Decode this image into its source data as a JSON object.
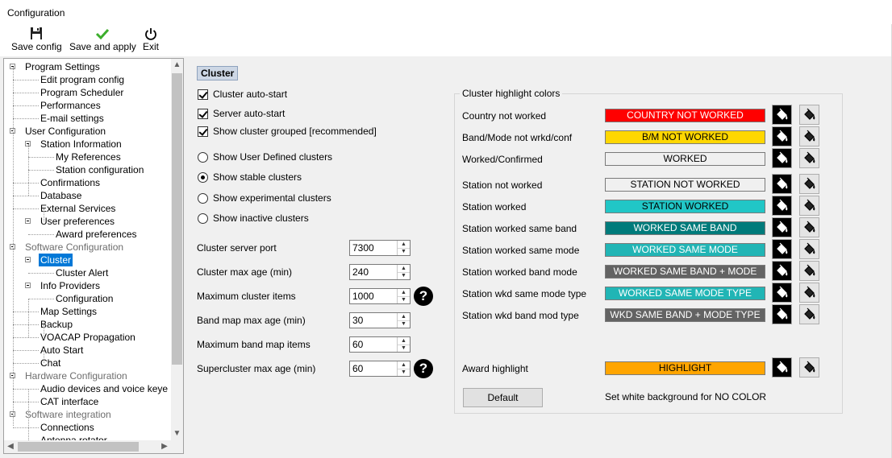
{
  "window": {
    "title": "Configuration"
  },
  "toolbar": {
    "save_config": "Save config",
    "save_apply": "Save and apply",
    "exit": "Exit"
  },
  "tree": {
    "nodes": [
      {
        "label": "Program Settings",
        "level": 0,
        "expanded": true,
        "grey": false
      },
      {
        "label": "Edit program config",
        "level": 1
      },
      {
        "label": "Program Scheduler",
        "level": 1
      },
      {
        "label": "Performances",
        "level": 1
      },
      {
        "label": "E-mail settings",
        "level": 1
      },
      {
        "label": "User Configuration",
        "level": 0,
        "expanded": true,
        "grey": false
      },
      {
        "label": "Station Information",
        "level": 1,
        "expanded": true
      },
      {
        "label": "My References",
        "level": 2
      },
      {
        "label": "Station configuration",
        "level": 2
      },
      {
        "label": "Confirmations",
        "level": 1
      },
      {
        "label": "Database",
        "level": 1
      },
      {
        "label": "External Services",
        "level": 1
      },
      {
        "label": "User preferences",
        "level": 1,
        "expanded": true
      },
      {
        "label": "Award preferences",
        "level": 2
      },
      {
        "label": "Software Configuration",
        "level": 0,
        "expanded": true,
        "grey": true
      },
      {
        "label": "Cluster",
        "level": 1,
        "expanded": true,
        "selected": true
      },
      {
        "label": "Cluster Alert",
        "level": 2
      },
      {
        "label": "Info Providers",
        "level": 1,
        "expanded": true
      },
      {
        "label": "Configuration",
        "level": 2
      },
      {
        "label": "Map Settings",
        "level": 1
      },
      {
        "label": "Backup",
        "level": 1
      },
      {
        "label": "VOACAP Propagation",
        "level": 1
      },
      {
        "label": "Auto Start",
        "level": 1
      },
      {
        "label": "Chat",
        "level": 1
      },
      {
        "label": "Hardware Configuration",
        "level": 0,
        "expanded": true,
        "grey": true
      },
      {
        "label": "Audio devices and voice keye",
        "level": 1
      },
      {
        "label": "CAT interface",
        "level": 1
      },
      {
        "label": "Software integration",
        "level": 0,
        "expanded": true,
        "grey": true
      },
      {
        "label": "Connections",
        "level": 1
      },
      {
        "label": "Antenna rotator",
        "level": 1
      }
    ]
  },
  "cluster": {
    "section_title": "Cluster",
    "checkboxes": [
      {
        "label": "Cluster auto-start",
        "checked": true
      },
      {
        "label": "Server auto-start",
        "checked": true
      },
      {
        "label": "Show cluster grouped [recommended]",
        "checked": true
      }
    ],
    "radios": [
      {
        "label": "Show User Defined clusters",
        "selected": false
      },
      {
        "label": "Show stable clusters",
        "selected": true
      },
      {
        "label": "Show experimental clusters",
        "selected": false
      },
      {
        "label": "Show inactive clusters",
        "selected": false
      }
    ],
    "fields": [
      {
        "label": "Cluster server port",
        "value": "7300",
        "help": false
      },
      {
        "label": "Cluster max age (min)",
        "value": "240",
        "help": false
      },
      {
        "label": "Maximum cluster items",
        "value": "1000",
        "help": true
      },
      {
        "label": "Band map max age (min)",
        "value": "30",
        "help": false
      },
      {
        "label": "Maximum band map items",
        "value": "60",
        "help": false
      },
      {
        "label": "Supercluster max age (min)",
        "value": "60",
        "help": true
      }
    ],
    "help_glyph": "?"
  },
  "highlight": {
    "group_title": "Cluster highlight colors",
    "rows": [
      {
        "label": "Country not worked",
        "text": "COUNTRY NOT WORKED",
        "bg": "#ff0000",
        "fg": "#ffffff"
      },
      {
        "label": "Band/Mode not wrkd/conf",
        "text": "B/M NOT WORKED",
        "bg": "#ffd700",
        "fg": "#000000"
      },
      {
        "label": "Worked/Confirmed",
        "text": "WORKED",
        "bg": "#f0f0f0",
        "fg": "#000000"
      },
      {
        "label": "Station not worked",
        "text": "STATION NOT WORKED",
        "bg": "#f0f0f0",
        "fg": "#000000"
      },
      {
        "label": "Station worked",
        "text": "STATION WORKED",
        "bg": "#21c6c6",
        "fg": "#000000"
      },
      {
        "label": "Station worked same band",
        "text": "WORKED SAME BAND",
        "bg": "#007b7b",
        "fg": "#ffffff"
      },
      {
        "label": "Station worked same mode",
        "text": "WORKED SAME MODE",
        "bg": "#21b5b5",
        "fg": "#ffffff"
      },
      {
        "label": "Station worked band mode",
        "text": "WORKED SAME BAND + MODE",
        "bg": "#636363",
        "fg": "#ffffff"
      },
      {
        "label": "Station wkd same mode type",
        "text": "WORKED SAME MODE TYPE",
        "bg": "#21b5b5",
        "fg": "#ffffff"
      },
      {
        "label": "Station wkd band mod type",
        "text": "WKD SAME BAND + MODE TYPE",
        "bg": "#636363",
        "fg": "#ffffff"
      }
    ],
    "award": {
      "label": "Award highlight",
      "text": "HIGHLIGHT",
      "bg": "#ffa500",
      "fg": "#000000"
    },
    "default_button": "Default",
    "note": "Set white background for NO COLOR"
  }
}
